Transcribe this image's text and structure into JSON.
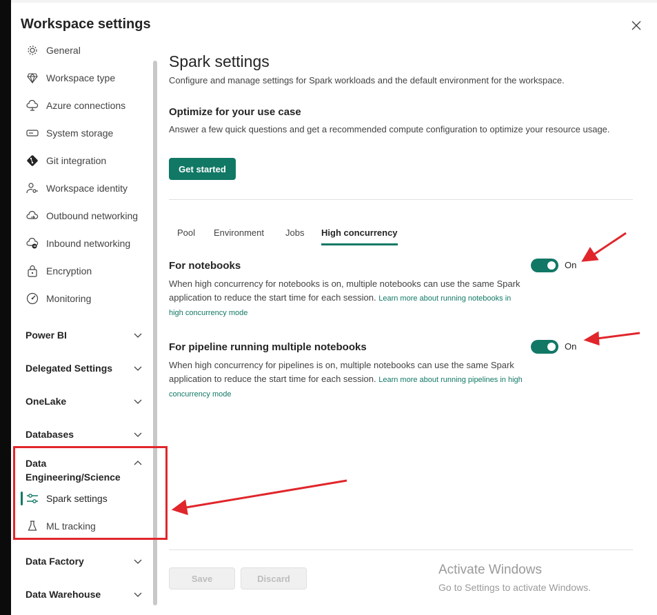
{
  "dialog": {
    "title": "Workspace settings"
  },
  "sidebar": {
    "items": [
      {
        "label": "General",
        "icon": "gear-icon"
      },
      {
        "label": "Workspace type",
        "icon": "diamond-icon"
      },
      {
        "label": "Azure connections",
        "icon": "cloud-connection-icon"
      },
      {
        "label": "System storage",
        "icon": "storage-icon"
      },
      {
        "label": "Git integration",
        "icon": "git-icon"
      },
      {
        "label": "Workspace identity",
        "icon": "identity-key-icon"
      },
      {
        "label": "Outbound networking",
        "icon": "cloud-outbound-icon"
      },
      {
        "label": "Inbound networking",
        "icon": "cloud-inbound-icon"
      },
      {
        "label": "Encryption",
        "icon": "lock-icon"
      },
      {
        "label": "Monitoring",
        "icon": "gauge-icon"
      }
    ],
    "sections": [
      {
        "label": "Power BI",
        "expanded": false
      },
      {
        "label": "Delegated Settings",
        "expanded": false
      },
      {
        "label": "OneLake",
        "expanded": false
      },
      {
        "label": "Databases",
        "expanded": false
      },
      {
        "label": "Data Engineering/Science",
        "line1": "Data",
        "line2": "Engineering/Science",
        "expanded": true
      },
      {
        "label": "Data Factory",
        "expanded": false
      },
      {
        "label": "Data Warehouse",
        "expanded": false
      }
    ],
    "sub_items": [
      {
        "label": "Spark settings",
        "icon": "sliders-icon",
        "active": true
      },
      {
        "label": "ML tracking",
        "icon": "flask-icon",
        "active": false
      }
    ]
  },
  "main": {
    "title": "Spark settings",
    "description": "Configure and manage settings for Spark workloads and the default environment for the workspace.",
    "optimize": {
      "title": "Optimize for your use case",
      "description": "Answer a few quick questions and get a recommended compute configuration to optimize your resource usage.",
      "button": "Get started"
    },
    "tabs": [
      {
        "label": "Pool",
        "active": false
      },
      {
        "label": "Environment",
        "active": false
      },
      {
        "label": "Jobs",
        "active": false
      },
      {
        "label": "High concurrency",
        "active": true
      }
    ],
    "settings": [
      {
        "title": "For notebooks",
        "description": "When high concurrency for notebooks is on, multiple notebooks can use the same Spark application to reduce the start time for each session.",
        "link": "Learn more about running notebooks in high concurrency mode",
        "toggle_on": true,
        "toggle_label": "On"
      },
      {
        "title": "For pipeline running multiple notebooks",
        "description": "When high concurrency for pipelines is on, multiple notebooks can use the same Spark application to reduce the start time for each session.",
        "link": "Learn more about running pipelines in high concurrency mode",
        "toggle_on": true,
        "toggle_label": "On"
      }
    ],
    "footer": {
      "save": "Save",
      "discard": "Discard"
    }
  },
  "watermark": {
    "line1": "Activate Windows",
    "line2": "Go to Settings to activate Windows."
  },
  "colors": {
    "accent": "#117865",
    "annotation": "#e0262b"
  }
}
